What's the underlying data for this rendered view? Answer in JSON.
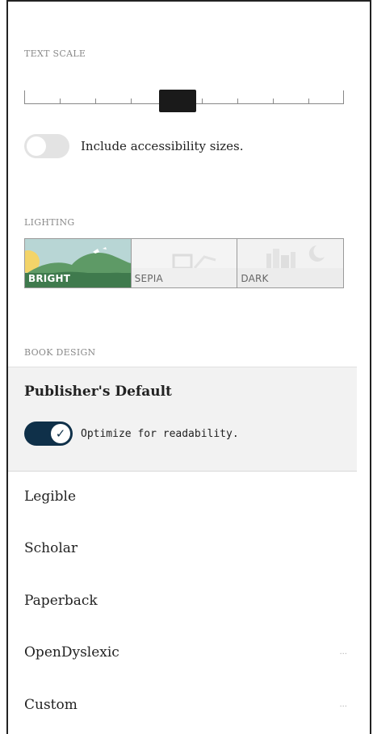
{
  "text_scale": {
    "label": "TEXT SCALE",
    "step_count": 10,
    "selected_step": 5,
    "accessibility_toggle": {
      "label": "Include accessibility sizes.",
      "on": false
    }
  },
  "lighting": {
    "label": "LIGHTING",
    "options": [
      {
        "label": "BRIGHT",
        "selected": true
      },
      {
        "label": "SEPIA",
        "selected": false
      },
      {
        "label": "DARK",
        "selected": false
      }
    ]
  },
  "book_design": {
    "label": "BOOK DESIGN",
    "selected": {
      "title": "Publisher's Default",
      "optimize_label": "Optimize for readability.",
      "optimize_on": true,
      "check_icon": "✓"
    },
    "items": [
      {
        "label": "Legible",
        "more": ""
      },
      {
        "label": "Scholar",
        "more": ""
      },
      {
        "label": "Paperback",
        "more": ""
      },
      {
        "label": "OpenDyslexic",
        "more": "..."
      },
      {
        "label": "Custom",
        "more": "..."
      }
    ]
  },
  "colors": {
    "toggle_on": "#0f3049",
    "bright_green": "#3f7a4d",
    "sun": "#f3d469",
    "sky": "#b8d6d5"
  }
}
